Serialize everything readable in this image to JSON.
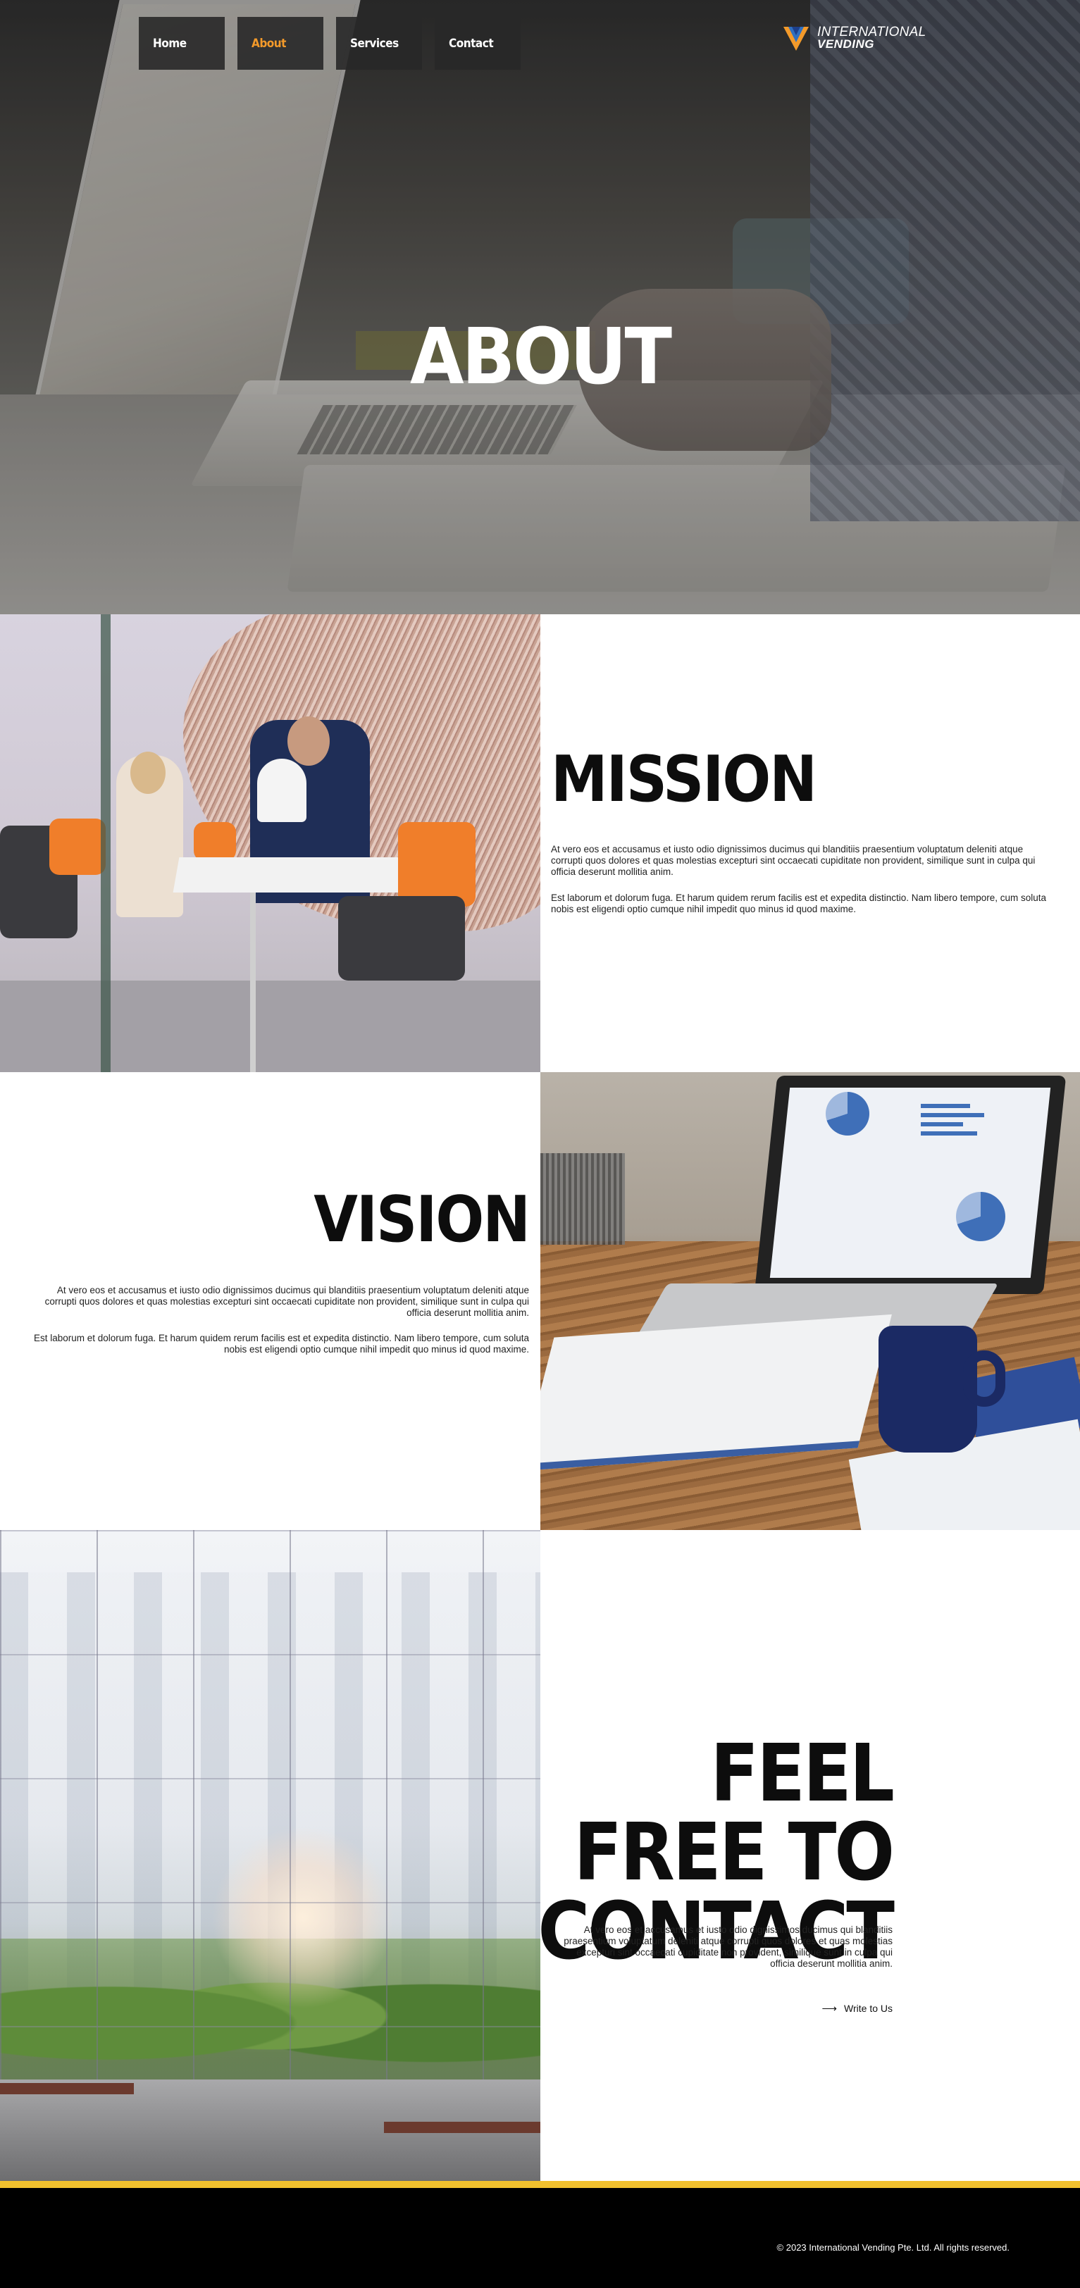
{
  "nav": {
    "items": [
      {
        "label": "Home",
        "active": false
      },
      {
        "label": "About",
        "active": true
      },
      {
        "label": "Services",
        "active": false
      },
      {
        "label": "Contact",
        "active": false
      }
    ]
  },
  "brand": {
    "line1": "INTERNATIONAL",
    "line2": "VENDING",
    "logo_icon": "triangle-v-logo-icon"
  },
  "hero": {
    "title": "ABOUT"
  },
  "mission": {
    "title": "MISSION",
    "paragraph1": "At vero eos et accusamus et iusto odio dignissimos ducimus qui blanditiis praesentium voluptatum deleniti atque corrupti quos dolores et quas molestias excepturi sint occaecati cupiditate non provident, similique sunt in culpa qui officia deserunt mollitia anim.",
    "paragraph2": "Est laborum et dolorum fuga. Et harum quidem rerum facilis est et expedita distinctio. Nam libero tempore, cum soluta nobis est eligendi optio cumque nihil impedit quo minus id quod maxime."
  },
  "vision": {
    "title": "VISION",
    "paragraph1": "At vero eos et accusamus et iusto odio dignissimos ducimus qui blanditiis praesentium voluptatum deleniti atque corrupti quos dolores et quas molestias excepturi sint occaecati cupiditate non provident, similique sunt in culpa qui officia deserunt mollitia anim.",
    "paragraph2": "Est laborum et dolorum fuga. Et harum quidem rerum facilis est et expedita distinctio. Nam libero tempore, cum soluta nobis est eligendi optio cumque nihil impedit quo minus id quod maxime."
  },
  "contact": {
    "title_line1": "FEEL FREE TO",
    "title_line2": "CONTACT",
    "paragraph": "At vero eos et accusamus et iusto odio dignissimos ducimus qui blanditiis praesentium voluptatum deleniti atque corrupti quos dolores et quas molestias excepturi sint occaecati cupiditate non provident, similique sunt in culpa qui officia deserunt mollitia anim.",
    "link_label": "Write to Us",
    "link_icon": "arrow-right-icon"
  },
  "footer": {
    "copyright": "© 2023 International Vending Pte. Ltd. All rights reserved."
  },
  "colors": {
    "accent": "#f39a2a",
    "footer_stripe": "#f2c12e",
    "footer_bg": "#000000",
    "nav_bg": "#282828"
  }
}
